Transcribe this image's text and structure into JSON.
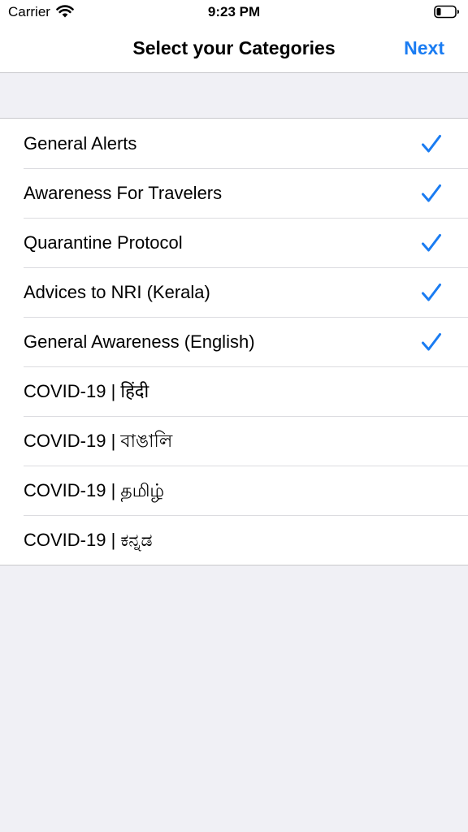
{
  "status_bar": {
    "carrier": "Carrier",
    "time": "9:23 PM"
  },
  "nav": {
    "title": "Select your Categories",
    "next_label": "Next"
  },
  "colors": {
    "accent": "#1a7cf2",
    "background": "#f0f0f5"
  },
  "categories": [
    {
      "label": "General Alerts",
      "checked": true
    },
    {
      "label": "Awareness For Travelers",
      "checked": true
    },
    {
      "label": "Quarantine Protocol",
      "checked": true
    },
    {
      "label": "Advices to NRI (Kerala)",
      "checked": true
    },
    {
      "label": "General Awareness (English)",
      "checked": true
    },
    {
      "label": "COVID-19 |  हिंदी",
      "checked": false
    },
    {
      "label": "COVID-19 | বাঙালি",
      "checked": false
    },
    {
      "label": "COVID-19 | தமிழ்",
      "checked": false
    },
    {
      "label": "COVID-19 | ಕನ್ನಡ",
      "checked": false
    }
  ]
}
